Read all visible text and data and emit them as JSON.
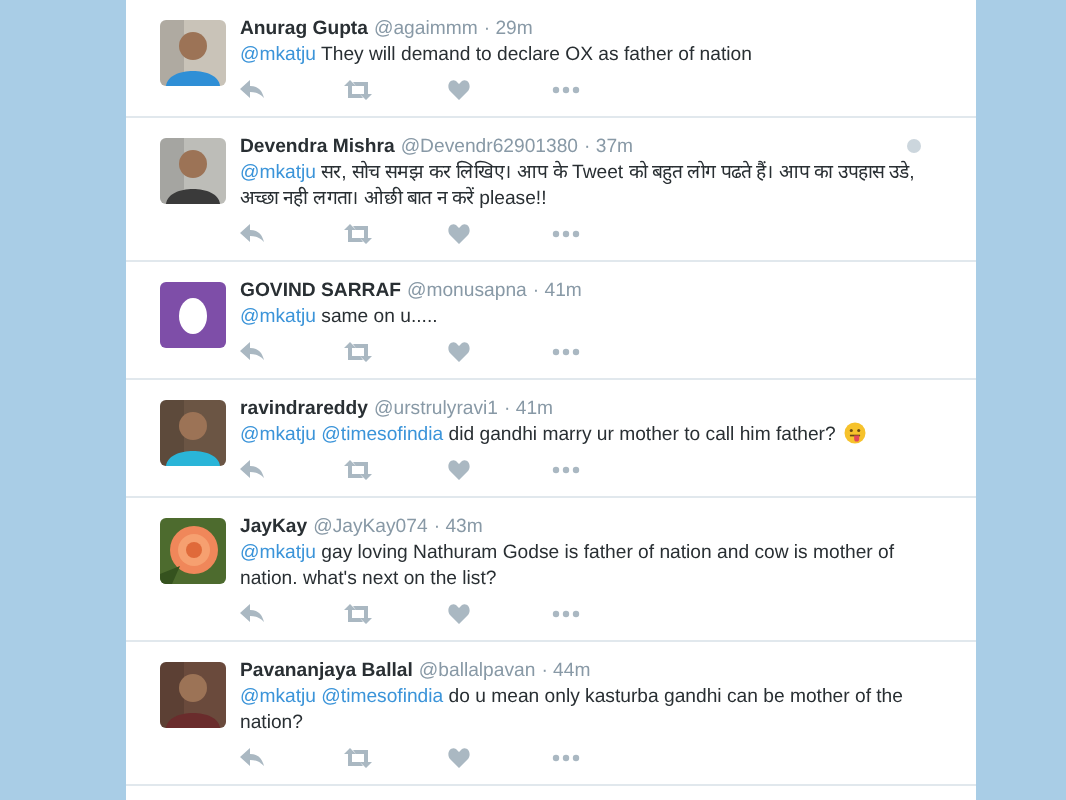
{
  "tweets": [
    {
      "name": "Anurag Gupta",
      "handle": "@agaimmm",
      "time": "· 29m",
      "mentions": [
        "@mkatju"
      ],
      "text": "They will demand to declare OX as father of nation",
      "avatar": {
        "kind": "picture"
      },
      "emoji": false,
      "menu_icon": false
    },
    {
      "name": "Devendra Mishra",
      "handle": "@Devendr62901380",
      "time": "· 37m",
      "mentions": [
        "@mkatju"
      ],
      "text": "सर,  सोच समझ कर लिखिए। आप के Tweet को बहुत लोग पढते हैं। आप का उपहास उडे, अच्छा नही लगता। ओछी बात न करें please!!",
      "avatar": {
        "kind": "picture"
      },
      "emoji": false,
      "menu_icon": true
    },
    {
      "name": "GOVIND SARRAF",
      "handle": "@monusapna",
      "time": "· 41m",
      "mentions": [
        "@mkatju"
      ],
      "text": " same on u.....",
      "avatar": {
        "kind": "egg"
      },
      "emoji": false,
      "menu_icon": false
    },
    {
      "name": "ravindrareddy",
      "handle": "@urstrulyravi1",
      "time": "· 41m",
      "mentions": [
        "@mkatju",
        "@timesofindia"
      ],
      "text": "did gandhi marry ur mother to call him father?",
      "avatar": {
        "kind": "picture"
      },
      "emoji": true,
      "menu_icon": false
    },
    {
      "name": "JayKay",
      "handle": "@JayKay074",
      "time": "· 43m",
      "mentions": [
        "@mkatju"
      ],
      "text": "gay loving Nathuram Godse is father of nation and cow is mother of nation. what's next on the list?",
      "avatar": {
        "kind": "picture"
      },
      "emoji": false,
      "menu_icon": false
    },
    {
      "name": "Pavananjaya Ballal",
      "handle": "@ballalpavan",
      "time": "· 44m",
      "mentions": [
        "@mkatju",
        "@timesofindia"
      ],
      "text": "do u mean only kasturba gandhi can be mother of the nation?",
      "avatar": {
        "kind": "picture"
      },
      "emoji": false,
      "menu_icon": false
    }
  ]
}
